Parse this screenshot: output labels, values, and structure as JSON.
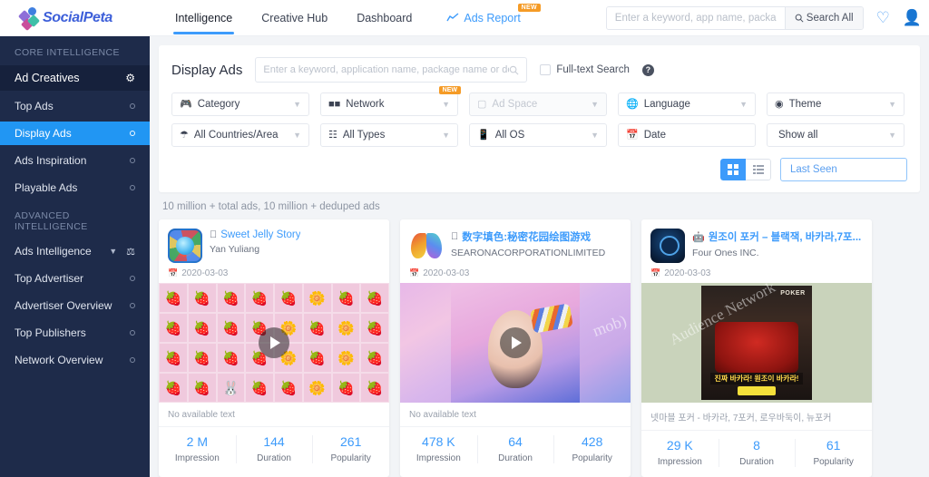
{
  "header": {
    "logo_text": "SocialPeta",
    "tabs": [
      {
        "label": "Intelligence",
        "active": true
      },
      {
        "label": "Creative Hub",
        "active": false
      },
      {
        "label": "Dashboard",
        "active": false
      }
    ],
    "ads_report": {
      "label": "Ads Report",
      "badge": "NEW",
      "icon": "chart-line-icon"
    },
    "search": {
      "placeholder": "Enter a keyword, app name, package name,",
      "value": "",
      "button_label": "Search All",
      "button_icon": "search-icon"
    },
    "favorite_icon": "heart-icon",
    "account_icon": "user-avatar-icon"
  },
  "sidebar": {
    "groups": [
      {
        "title": "CORE INTELLIGENCE",
        "items": [
          {
            "label": "Ad Creatives",
            "type": "header",
            "icon": "gear-icon"
          },
          {
            "label": "Top Ads",
            "type": "item",
            "active": false
          },
          {
            "label": "Display Ads",
            "type": "item",
            "active": true
          },
          {
            "label": "Ads Inspiration",
            "type": "item",
            "active": false
          },
          {
            "label": "Playable Ads",
            "type": "item",
            "active": false
          }
        ]
      },
      {
        "title": "ADVANCED INTELLIGENCE",
        "items": [
          {
            "label": "Ads Intelligence",
            "type": "header",
            "icon": "flag-icon",
            "caret": "chevron-down-icon"
          },
          {
            "label": "Top Advertiser",
            "type": "item",
            "active": false
          },
          {
            "label": "Advertiser Overview",
            "type": "item",
            "active": false
          },
          {
            "label": "Top Publishers",
            "type": "item",
            "active": false
          },
          {
            "label": "Network Overview",
            "type": "item",
            "active": false
          }
        ]
      }
    ]
  },
  "panel": {
    "title": "Display Ads",
    "search": {
      "placeholder": "Enter a keyword, application name, package name or domain name",
      "value": "",
      "icon": "search-icon"
    },
    "fulltext_label": "Full-text Search",
    "fulltext_checked": false,
    "help_icon": "question-mark-icon",
    "filters_row1": [
      {
        "label": "Category",
        "icon": "gamepad-icon",
        "disabled": false,
        "badge": ""
      },
      {
        "label": "Network",
        "icon": "grid-dots-icon",
        "disabled": false,
        "badge": "NEW"
      },
      {
        "label": "Ad Space",
        "icon": "ad-monitor-icon",
        "disabled": true,
        "badge": ""
      },
      {
        "label": "Language",
        "icon": "globe-icon",
        "disabled": false,
        "badge": ""
      },
      {
        "label": "Theme",
        "icon": "theme-icon",
        "disabled": false,
        "badge": ""
      }
    ],
    "filters_row2": [
      {
        "label": "All Countries/Area",
        "icon": "globe-pin-icon",
        "disabled": false,
        "badge": ""
      },
      {
        "label": "All Types",
        "icon": "blocks-icon",
        "disabled": false,
        "badge": ""
      },
      {
        "label": "All OS",
        "icon": "mobile-icon",
        "disabled": false,
        "badge": ""
      },
      {
        "label": "Date",
        "icon": "calendar-icon",
        "disabled": false,
        "badge": "",
        "no_caret": true
      },
      {
        "label": "Show all",
        "icon": "",
        "disabled": false,
        "badge": ""
      }
    ]
  },
  "toolbar": {
    "grid_view_icon": "grid-view-icon",
    "list_view_icon": "list-view-icon",
    "grid_active": true,
    "sort_label": "Last Seen"
  },
  "results_count": "10 million + total ads, 10 million + deduped ads",
  "cards": [
    {
      "app_name": "Sweet Jelly Story",
      "developer": "Yan Yuliang",
      "platform_icon": "apple-icon",
      "date": "2020-03-03",
      "ad_text": "No available text",
      "has_play_button": true,
      "stats": [
        {
          "value": "2 M",
          "label": "Impression"
        },
        {
          "value": "144",
          "label": "Duration"
        },
        {
          "value": "261",
          "label": "Popularity"
        }
      ]
    },
    {
      "app_name": "数字填色:秘密花园绘图游戏",
      "developer": "SEARONACORPORATIONLIMITED",
      "platform_icon": "apple-icon",
      "date": "2020-03-03",
      "ad_text": "No available text",
      "has_play_button": true,
      "watermark": "mob)",
      "stats": [
        {
          "value": "478 K",
          "label": "Impression"
        },
        {
          "value": "64",
          "label": "Duration"
        },
        {
          "value": "428",
          "label": "Popularity"
        }
      ]
    },
    {
      "app_name": "원조이 포커 – 블랙잭, 바카라,7포...",
      "developer": "Four Ones INC.",
      "platform_icon": "android-icon",
      "date": "2020-03-03",
      "ad_text": "넷마블 포커 - 바카라, 7포커, 로우바둑이, 뉴포커",
      "has_play_button": false,
      "watermark": "Audience Network",
      "banner_text": "진짜 바카라! 원조이 바카라!",
      "brand_text": "POKER",
      "stats": [
        {
          "value": "29 K",
          "label": "Impression"
        },
        {
          "value": "8",
          "label": "Duration"
        },
        {
          "value": "61",
          "label": "Popularity"
        }
      ]
    }
  ],
  "colors": {
    "accent_blue": "#3d9bfb",
    "sidebar_bg": "#1e2b4a",
    "badge_orange": "#f59b26"
  }
}
